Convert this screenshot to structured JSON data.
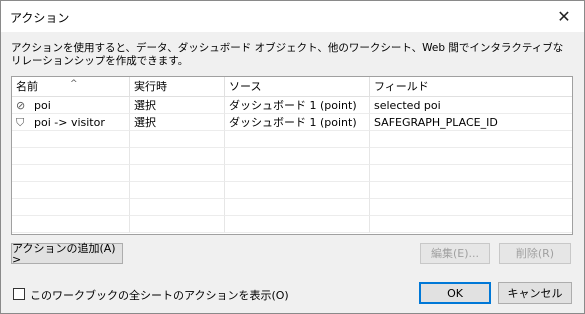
{
  "window": {
    "title": "アクション",
    "close_glyph": "✕"
  },
  "description": "アクションを使用すると、データ、ダッシュボード オブジェクト、他のワークシート、Web 間でインタラクティブなリレーションシップを作成できます。",
  "table": {
    "columns": [
      "名前",
      "実行時",
      "ソース",
      "フィールド"
    ],
    "sort_indicator": "^",
    "rows": [
      {
        "icon": "link-icon",
        "icon_glyph": "⊘",
        "name": "poi",
        "run_on": "選択",
        "source": "ダッシュボード 1 (point)",
        "field": "selected poi"
      },
      {
        "icon": "filter-icon",
        "icon_glyph": "⛉",
        "name": "poi -> visitor",
        "run_on": "選択",
        "source": "ダッシュボード 1 (point)",
        "field": "SAFEGRAPH_PLACE_ID"
      }
    ]
  },
  "buttons": {
    "add_action": "アクションの追加(A) >",
    "edit": "編集(E)...",
    "delete": "削除(R)",
    "ok": "OK",
    "cancel": "キャンセル"
  },
  "show_all_checkbox": {
    "label": "このワークブックの全シートのアクションを表示(O)",
    "checked": false
  }
}
